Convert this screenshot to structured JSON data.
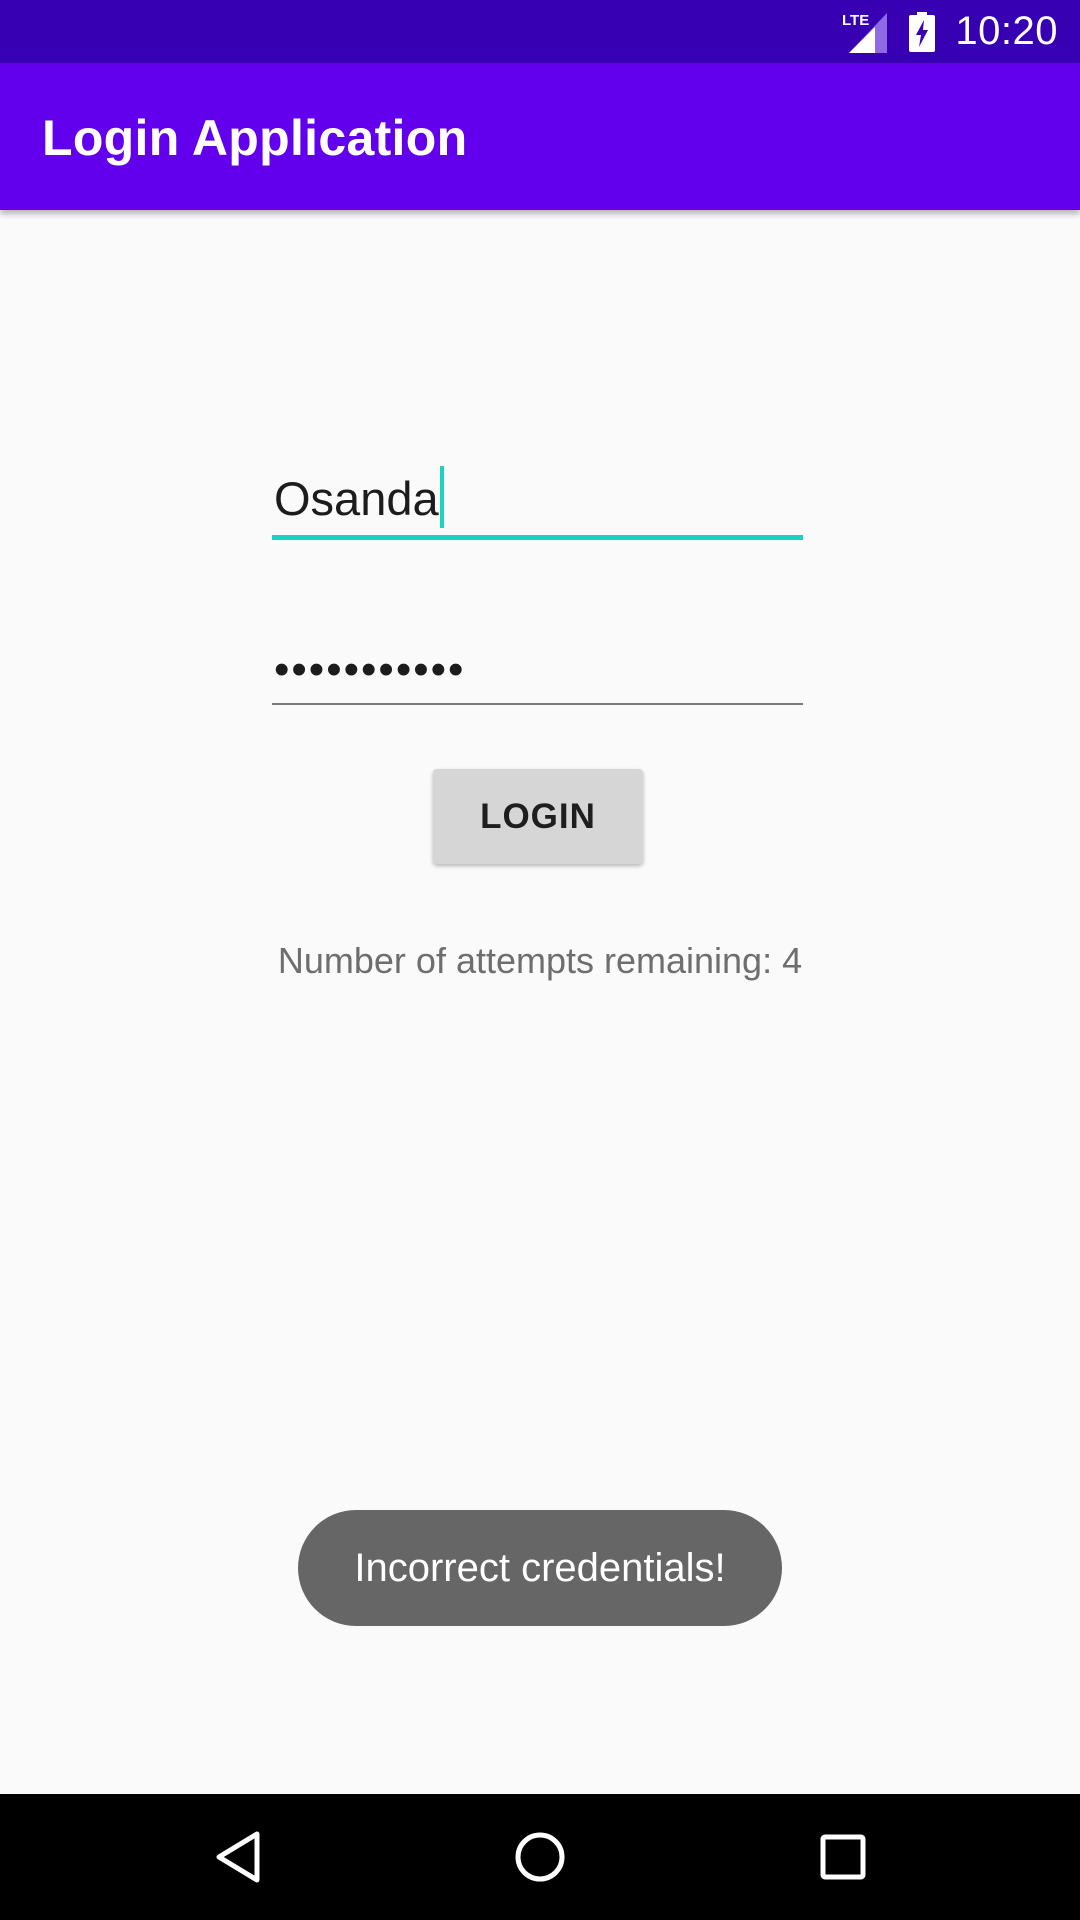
{
  "status_bar": {
    "network_label": "LTE",
    "time": "10:20",
    "icons": [
      "lte-signal-icon",
      "battery-charging-icon"
    ]
  },
  "app_bar": {
    "title": "Login Application"
  },
  "form": {
    "username_value": "Osanda",
    "password_value": "•••••••••••",
    "login_label": "LOGIN",
    "attempts_text": "Number of attempts remaining: 4"
  },
  "toast": {
    "message": "Incorrect credentials!"
  },
  "nav_bar": {
    "icons": [
      "back-icon",
      "home-icon",
      "recents-icon"
    ]
  },
  "colors": {
    "status_bar": "#3700B3",
    "primary": "#6200EE",
    "accent": "#1DD1C1",
    "button": "#D6D6D6",
    "toast": "#666666",
    "background": "#FAFAFA"
  }
}
